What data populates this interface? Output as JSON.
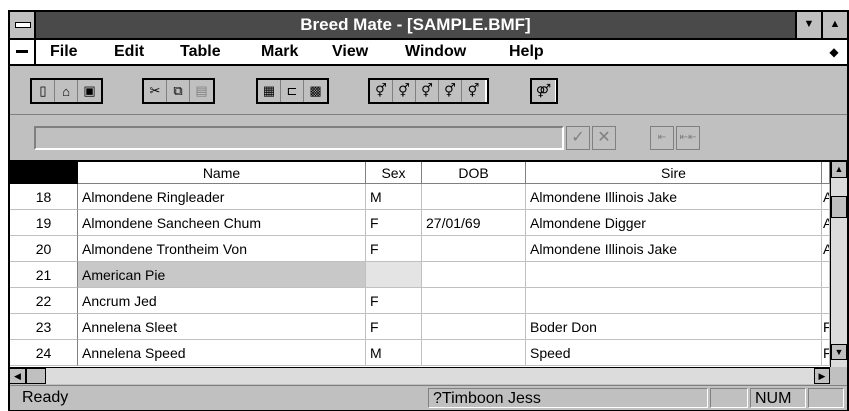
{
  "window": {
    "title": "Breed Mate - [SAMPLE.BMF]"
  },
  "menu": {
    "items": [
      "File",
      "Edit",
      "Table",
      "Mark",
      "View",
      "Window",
      "Help"
    ]
  },
  "toolbar": {
    "buttons": [
      "new-icon",
      "open-icon",
      "save-icon",
      "cut-icon",
      "copy-icon",
      "paste-icon",
      "table-icon",
      "tree-icon",
      "form-icon",
      "pedigree-1-icon",
      "pedigree-2-icon",
      "pedigree-3-icon",
      "pedigree-4-icon",
      "pedigree-5-icon",
      "mate-icon"
    ]
  },
  "editline": {
    "value": "",
    "confirm_label": "✓",
    "cancel_label": "✕",
    "prev_label": "⇤",
    "first_label": "⇤⇤"
  },
  "grid": {
    "columns": [
      "Name",
      "Sex",
      "DOB",
      "Sire"
    ],
    "rows": [
      {
        "num": "18",
        "name": "Almondene Ringleader",
        "sex": "M",
        "dob": "",
        "sire": "Almondene Illinois Jake",
        "extra": "A"
      },
      {
        "num": "19",
        "name": "Almondene Sancheen Chum",
        "sex": "F",
        "dob": "27/01/69",
        "sire": "Almondene Digger",
        "extra": "A"
      },
      {
        "num": "20",
        "name": "Almondene Trontheim Von",
        "sex": "F",
        "dob": "",
        "sire": "Almondene Illinois Jake",
        "extra": "A"
      },
      {
        "num": "21",
        "name": "American Pie",
        "sex": "",
        "dob": "",
        "sire": "",
        "extra": ""
      },
      {
        "num": "22",
        "name": "Ancrum Jed",
        "sex": "F",
        "dob": "",
        "sire": "",
        "extra": ""
      },
      {
        "num": "23",
        "name": "Annelena Sleet",
        "sex": "F",
        "dob": "",
        "sire": "Boder Don",
        "extra": "F"
      },
      {
        "num": "24",
        "name": "Annelena Speed",
        "sex": "M",
        "dob": "",
        "sire": "Speed",
        "extra": "F"
      }
    ]
  },
  "status": {
    "message": "Ready",
    "record": "?Timboon Jess",
    "num": "NUM"
  },
  "colors": {
    "title_bar": "#4a4a4a",
    "face": "#c0c0c0",
    "selected_cell": "#c8c8c8"
  }
}
